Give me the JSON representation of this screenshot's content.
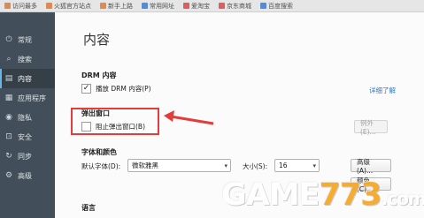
{
  "bookmarks": [
    {
      "label": "访问最多",
      "color": "#e07b39"
    },
    {
      "label": "火狐官方站点",
      "color": "#e07b39"
    },
    {
      "label": "新手上路",
      "color": "#e07b39"
    },
    {
      "label": "常用网址",
      "color": "#3b7bd4"
    },
    {
      "label": "爱淘宝",
      "color": "#d44"
    },
    {
      "label": "京东商城",
      "color": "#d44"
    },
    {
      "label": "百度搜索",
      "color": "#3b7bd4"
    }
  ],
  "sidebar": {
    "items": [
      {
        "label": "常规",
        "icon": "switch-icon",
        "glyph": "⏻"
      },
      {
        "label": "搜索",
        "icon": "search-icon",
        "glyph": "⌕"
      },
      {
        "label": "内容",
        "icon": "document-icon",
        "glyph": "▤"
      },
      {
        "label": "应用程序",
        "icon": "applications-icon",
        "glyph": "▦"
      },
      {
        "label": "隐私",
        "icon": "mask-icon",
        "glyph": "◉"
      },
      {
        "label": "安全",
        "icon": "lock-icon",
        "glyph": "🔒"
      },
      {
        "label": "同步",
        "icon": "sync-icon",
        "glyph": "↻"
      },
      {
        "label": "高级",
        "icon": "gear-icon",
        "glyph": "⚙"
      }
    ],
    "active_index": 2
  },
  "main": {
    "title": "内容",
    "drm": {
      "heading": "DRM 内容",
      "checkbox_label": "播放 DRM 内容(P)",
      "checked": true,
      "link": "详细了解"
    },
    "popup": {
      "heading": "弹出窗口",
      "checkbox_label": "阻止弹出窗口(B)",
      "checked": false,
      "exceptions_button": "例外(E)..."
    },
    "fonts": {
      "heading": "字体和颜色",
      "default_font_label": "默认字体(D):",
      "default_font_value": "微软雅黑",
      "size_label": "大小(S):",
      "size_value": "16",
      "advanced_button": "高级(A)...",
      "colors_button": "颜色(C)..."
    },
    "language": {
      "heading": "语言"
    }
  },
  "watermark": {
    "text_a": "GAME",
    "text_b": "773",
    "text_c": ".com"
  }
}
